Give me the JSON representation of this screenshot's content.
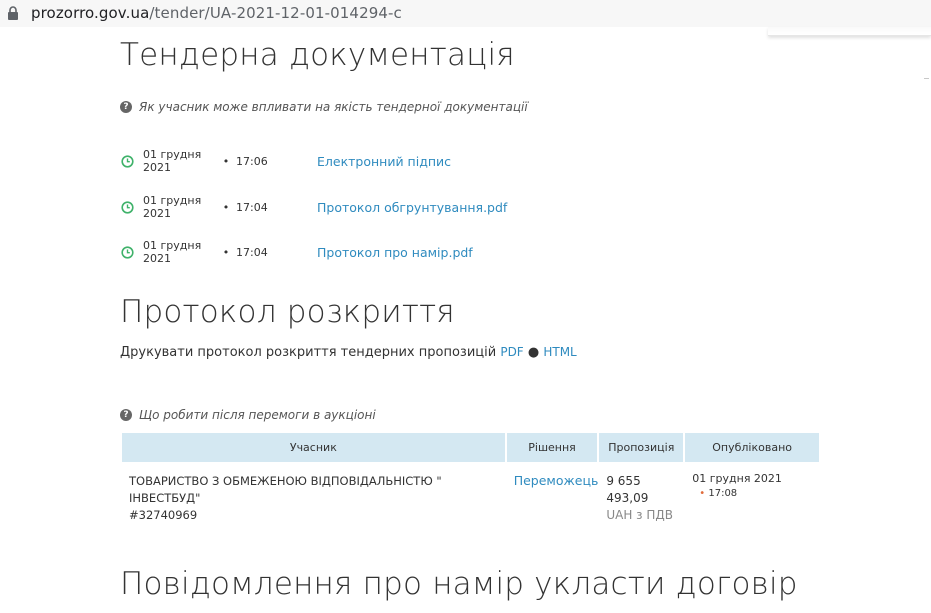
{
  "browser": {
    "url_host": "prozorro.gov.ua",
    "url_path": "/tender/UA-2021-12-01-014294-c"
  },
  "tender_docs": {
    "title": "Тендерна документація",
    "hint": "Як учасник може впливати на якість тендерної документації",
    "documents": [
      {
        "date": "01 грудня 2021",
        "time": "17:06",
        "name": "Електронний підпис"
      },
      {
        "date": "01 грудня 2021",
        "time": "17:04",
        "name": "Протокол обгрунтування.pdf"
      },
      {
        "date": "01 грудня 2021",
        "time": "17:04",
        "name": "Протокол про намір.pdf"
      }
    ]
  },
  "opening_protocol": {
    "title": "Протокол розкриття",
    "print_text": "Друкувати протокол розкриття тендерних пропозицій",
    "pdf_label": "PDF",
    "html_label": "HTML",
    "hint": "Що робити після перемоги в аукціоні",
    "table": {
      "headers": [
        "Учасник",
        "Рішення",
        "Пропозиція",
        "Опубліковано"
      ],
      "row": {
        "participant_line1": "ТОВАРИСТВО З ОБМЕЖЕНОЮ ВІДПОВІДАЛЬНІСТЮ \"",
        "participant_line2": "ІНВЕСТБУД\"",
        "participant_id": "#32740969",
        "decision": "Переможець",
        "offer_line1": "9 655",
        "offer_line2": "493,09",
        "offer_currency": "UAH з ПДВ",
        "published_date": "01 грудня 2021",
        "published_time": "17:08"
      }
    }
  },
  "notice": {
    "title": "Повідомлення про намір укласти договір"
  },
  "colors": {
    "link": "#2f8bbf",
    "header_bg": "#d4e8f2",
    "clock_green": "#3fb26a"
  }
}
